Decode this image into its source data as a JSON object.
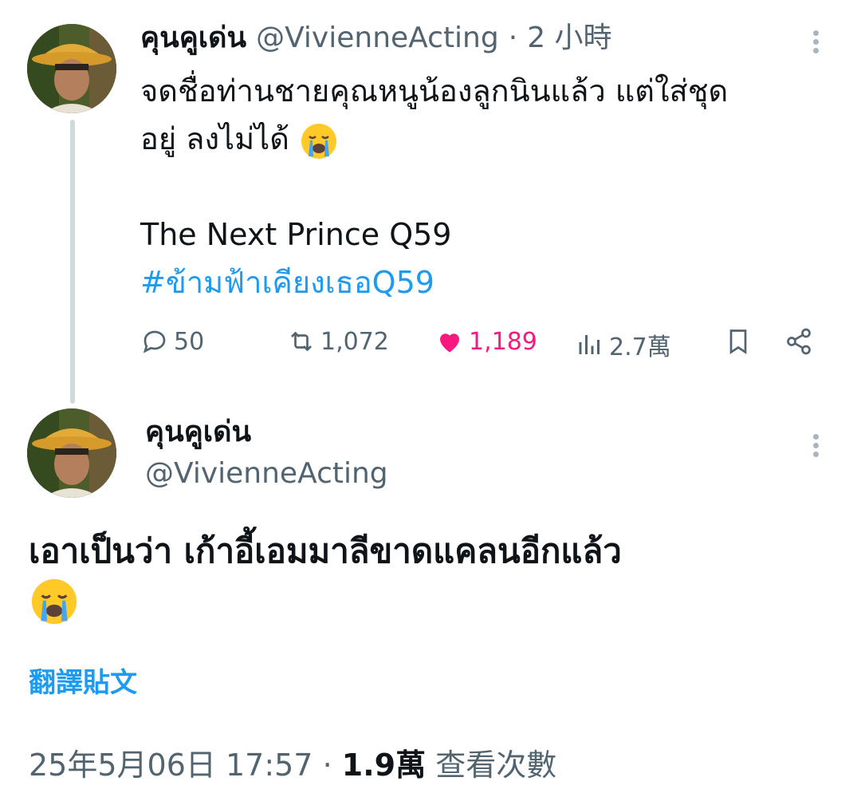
{
  "parent_tweet": {
    "display_name": "คุนคูเด่น",
    "handle": "@VivienneActing",
    "time_sep": "·",
    "time": "2 小時",
    "text_line1": "จดชื่อท่านชายคุณหนูน้องลูกนินแล้ว แต่ใส่ชุด",
    "text_line2": "อยู่ ลงไม่ได้",
    "text_line3": "The Next Prince Q59",
    "hashtag": "#ข้ามฟ้าเคียงเธอQ59",
    "replies": "50",
    "retweets": "1,072",
    "likes": "1,189",
    "views": "2.7萬"
  },
  "main_tweet": {
    "display_name": "คุนคูเด่น",
    "handle": "@VivienneActing",
    "text": "เอาเป็นว่า เก้าอี้เอมมาลีขาดแคลนอีกแล้ว",
    "translate": "翻譯貼文",
    "date": "25年5月06日 17:57",
    "sep": "·",
    "view_count": "1.9萬",
    "view_label": "查看次數"
  },
  "icons": {
    "reply": "reply-icon",
    "retweet": "retweet-icon",
    "like": "heart-icon",
    "views": "views-icon",
    "bookmark": "bookmark-icon",
    "share": "share-icon",
    "emoji": "crying-face-emoji"
  },
  "colors": {
    "link": "#1d9bf0",
    "like": "#f91880",
    "secondary": "#536471"
  }
}
